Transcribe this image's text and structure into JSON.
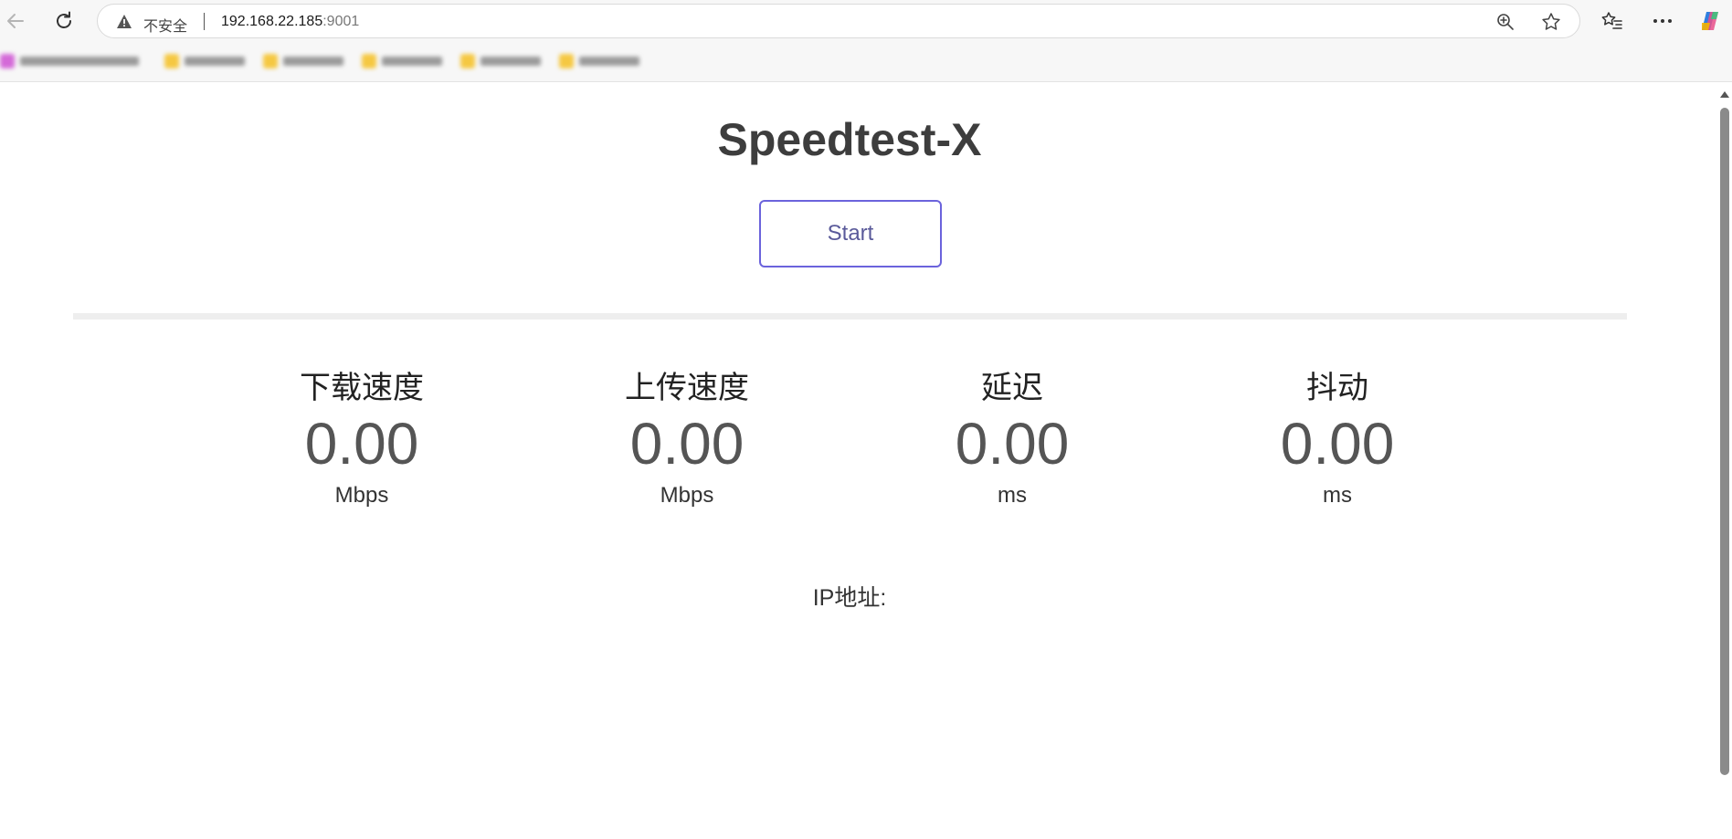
{
  "browser": {
    "security_label": "不安全",
    "url_host": "192.168.22.185",
    "url_port": ":9001",
    "icons": {
      "back": "back-arrow-icon",
      "reload": "reload-icon",
      "warning": "warning-icon",
      "zoom": "zoom-in-icon",
      "favorite": "star-icon",
      "favorites_list": "favorites-list-icon",
      "more": "more-icon",
      "copilot": "copilot-icon"
    }
  },
  "page": {
    "title": "Speedtest-X",
    "start_label": "Start",
    "progress_fraction": 0,
    "accent_color": "#6b63dc",
    "metrics": [
      {
        "label": "下载速度",
        "value": "0.00",
        "unit": "Mbps"
      },
      {
        "label": "上传速度",
        "value": "0.00",
        "unit": "Mbps"
      },
      {
        "label": "延迟",
        "value": "0.00",
        "unit": "ms"
      },
      {
        "label": "抖动",
        "value": "0.00",
        "unit": "ms"
      }
    ],
    "ip_label": "IP地址:"
  }
}
